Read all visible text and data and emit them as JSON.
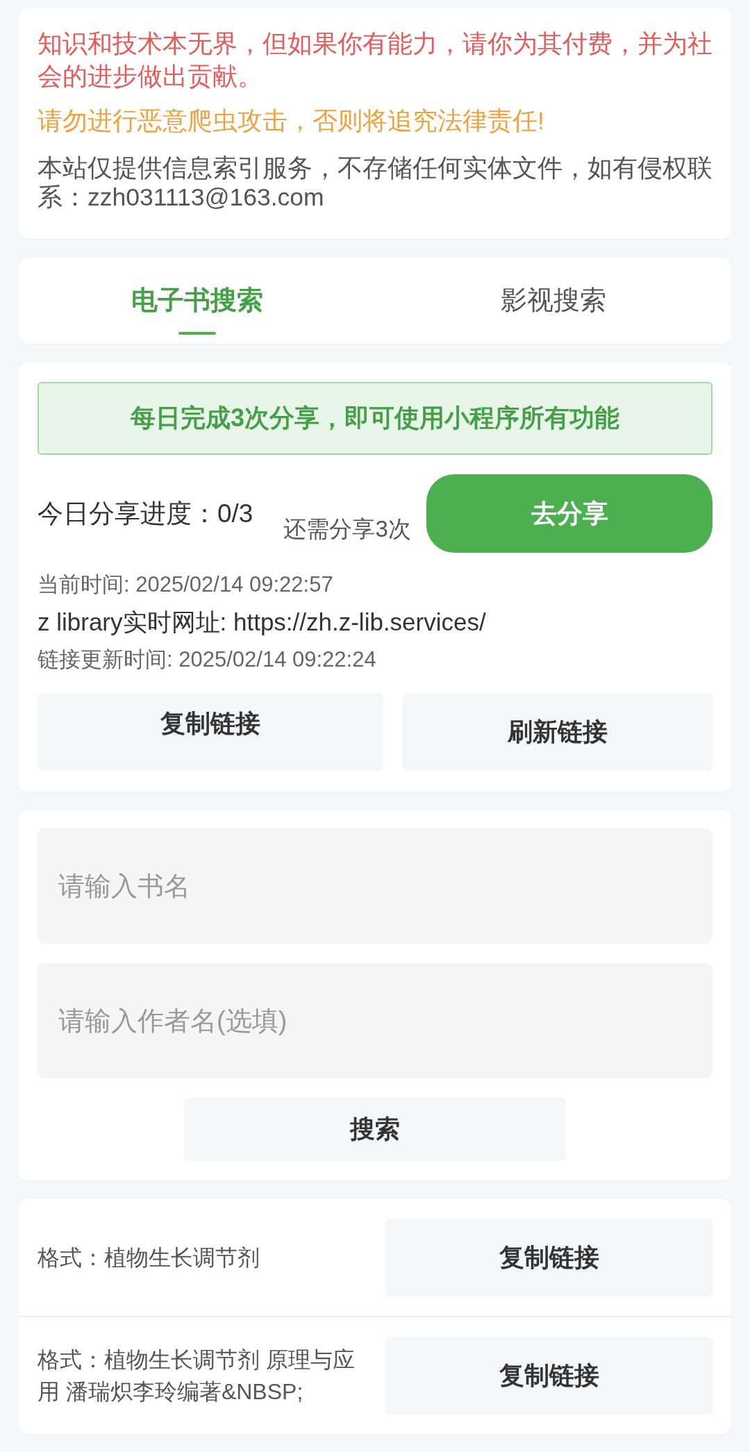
{
  "notice": {
    "lines": [
      {
        "kind": "warning",
        "text": "知识和技术本无界，但如果你有能力，请你为其付费，并为社会的进步做出贡献。"
      },
      {
        "kind": "caution",
        "text": "请勿进行恶意爬虫攻击，否则将追究法律责任!"
      },
      {
        "kind": "info",
        "text": "本站仅提供信息索引服务，不存储任何实体文件，如有侵权联系：zzh031113@163.com"
      }
    ]
  },
  "tabs": [
    {
      "label": "电子书搜索",
      "selected": true
    },
    {
      "label": "影视搜索",
      "selected": false
    }
  ],
  "share_panel": {
    "banner": "每日完成3次分享，即可使用小程序所有功能",
    "progress_label": "今日分享进度：0/3",
    "remaining": "还需分享3次",
    "share_button": "去分享",
    "current_time": "当前时间: 2025/02/14 09:22:57",
    "live_url": "z library实时网址: https://zh.z-lib.services/",
    "link_updated": "链接更新时间: 2025/02/14 09:22:24",
    "buttons": [
      "复制链接",
      "刷新链接"
    ]
  },
  "search_form": {
    "fields": [
      {
        "placeholder": "请输入书名"
      },
      {
        "placeholder": "请输入作者名(选填)"
      }
    ],
    "button": "搜索"
  },
  "results": [
    {
      "format": "格式：植物生长调节剂",
      "button": "复制链接"
    },
    {
      "format": "格式：植物生长调节剂 原理与应用 潘瑞炽李玲编著&NBSP;",
      "button": "复制链接"
    }
  ]
}
